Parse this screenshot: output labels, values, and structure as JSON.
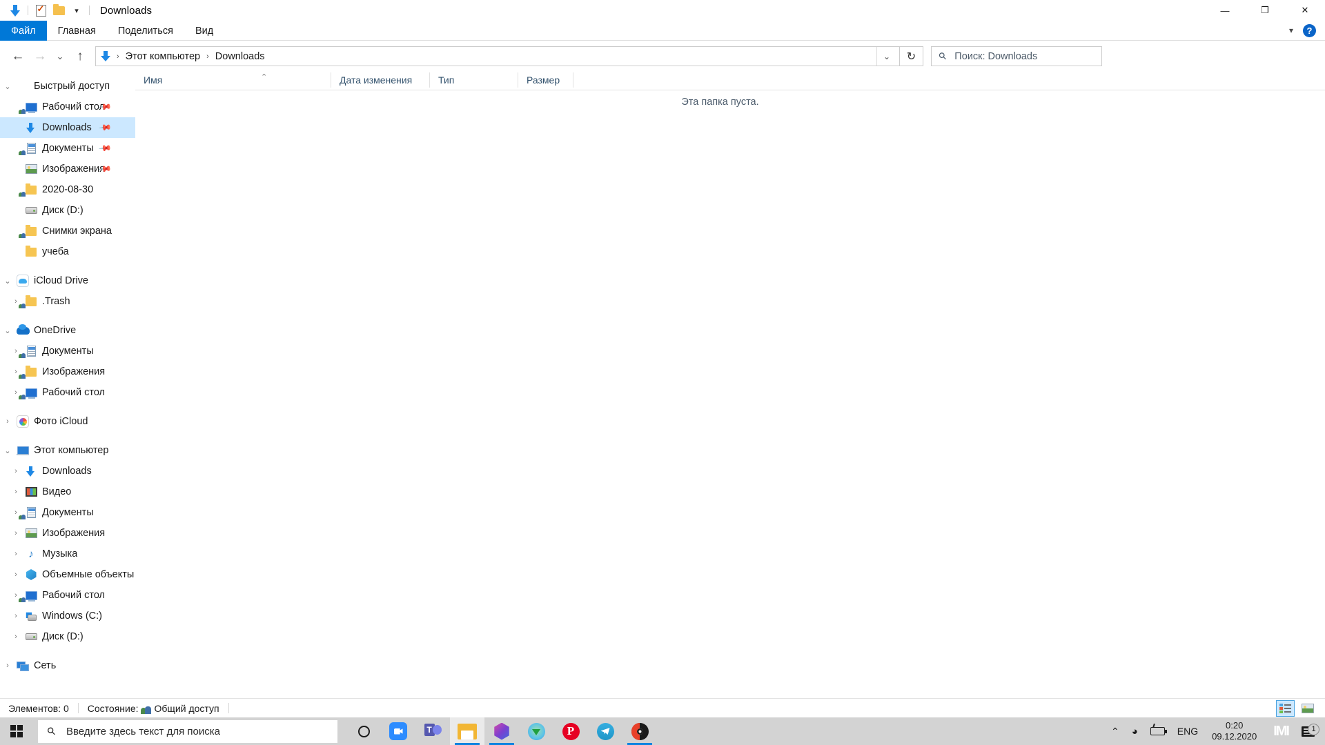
{
  "window": {
    "title": "Downloads",
    "quick_access_toolbar": [
      {
        "name": "downloads-icon",
        "glyph": "download-arrow"
      },
      {
        "name": "properties-icon",
        "glyph": "checked-document"
      },
      {
        "name": "new-folder-icon",
        "glyph": "folder"
      },
      {
        "name": "customize-qat-icon",
        "glyph": "chevron-down"
      }
    ],
    "controls": {
      "minimize": "—",
      "maximize": "❐",
      "close": "✕"
    }
  },
  "ribbon": {
    "tabs": [
      {
        "label": "Файл",
        "active": true
      },
      {
        "label": "Главная",
        "active": false
      },
      {
        "label": "Поделиться",
        "active": false
      },
      {
        "label": "Вид",
        "active": false
      }
    ],
    "collapse_icon": "chevron-down-icon",
    "help_label": "?"
  },
  "navigation": {
    "back": "←",
    "forward": "→",
    "recent": "⌄",
    "up": "↑",
    "breadcrumbs": [
      "Этот компьютер",
      "Downloads"
    ],
    "breadcrumb_separator": "›",
    "history_chevron": "⌄",
    "refresh_icon": "↻",
    "search_placeholder": "Поиск: Downloads"
  },
  "sidebar": {
    "items": [
      {
        "label": "Быстрый доступ",
        "icon": "star-icon",
        "depth": 0,
        "expander": "⌄",
        "pinned": false,
        "selected": false
      },
      {
        "label": "Рабочий стол",
        "icon": "desktop-icon",
        "depth": 1,
        "expander": "",
        "pinned": true,
        "selected": false
      },
      {
        "label": "Downloads",
        "icon": "download-icon",
        "depth": 1,
        "expander": "",
        "pinned": true,
        "selected": true
      },
      {
        "label": "Документы",
        "icon": "documents-icon",
        "depth": 1,
        "expander": "",
        "pinned": true,
        "selected": false
      },
      {
        "label": "Изображения",
        "icon": "pictures-icon",
        "depth": 1,
        "expander": "",
        "pinned": true,
        "selected": false
      },
      {
        "label": "2020-08-30",
        "icon": "folder-shared-icon",
        "depth": 1,
        "expander": "",
        "pinned": false,
        "selected": false
      },
      {
        "label": "Диск  (D:)",
        "icon": "disk-icon",
        "depth": 1,
        "expander": "",
        "pinned": false,
        "selected": false
      },
      {
        "label": "Снимки экрана",
        "icon": "folder-shared-icon",
        "depth": 1,
        "expander": "",
        "pinned": false,
        "selected": false
      },
      {
        "label": "учеба",
        "icon": "folder-icon",
        "depth": 1,
        "expander": "",
        "pinned": false,
        "selected": false
      },
      {
        "label": "iCloud Drive",
        "icon": "icloud-icon",
        "depth": 0,
        "expander": "⌄",
        "pinned": false,
        "selected": false
      },
      {
        "label": ".Trash",
        "icon": "folder-shared-icon",
        "depth": 1,
        "expander": "›",
        "pinned": false,
        "selected": false
      },
      {
        "label": "OneDrive",
        "icon": "onedrive-icon",
        "depth": 0,
        "expander": "⌄",
        "pinned": false,
        "selected": false
      },
      {
        "label": "Документы",
        "icon": "documents-icon",
        "depth": 1,
        "expander": "›",
        "pinned": false,
        "selected": false
      },
      {
        "label": "Изображения",
        "icon": "folder-shared-icon",
        "depth": 1,
        "expander": "›",
        "pinned": false,
        "selected": false
      },
      {
        "label": "Рабочий стол",
        "icon": "desktop-icon",
        "depth": 1,
        "expander": "›",
        "pinned": false,
        "selected": false
      },
      {
        "label": "Фото iCloud",
        "icon": "photos-icon",
        "depth": 0,
        "expander": "›",
        "pinned": false,
        "selected": false
      },
      {
        "label": "Этот компьютер",
        "icon": "this-pc-icon",
        "depth": 0,
        "expander": "⌄",
        "pinned": false,
        "selected": false
      },
      {
        "label": "Downloads",
        "icon": "download-icon",
        "depth": 1,
        "expander": "›",
        "pinned": false,
        "selected": false
      },
      {
        "label": "Видео",
        "icon": "videos-icon",
        "depth": 1,
        "expander": "›",
        "pinned": false,
        "selected": false
      },
      {
        "label": "Документы",
        "icon": "documents-icon",
        "depth": 1,
        "expander": "›",
        "pinned": false,
        "selected": false
      },
      {
        "label": "Изображения",
        "icon": "pictures-icon",
        "depth": 1,
        "expander": "›",
        "pinned": false,
        "selected": false
      },
      {
        "label": "Музыка",
        "icon": "music-icon",
        "depth": 1,
        "expander": "›",
        "pinned": false,
        "selected": false
      },
      {
        "label": "Объемные объекты",
        "icon": "3d-objects-icon",
        "depth": 1,
        "expander": "›",
        "pinned": false,
        "selected": false
      },
      {
        "label": "Рабочий стол",
        "icon": "desktop-icon",
        "depth": 1,
        "expander": "›",
        "pinned": false,
        "selected": false
      },
      {
        "label": "Windows (C:)",
        "icon": "windows-drive-icon",
        "depth": 1,
        "expander": "›",
        "pinned": false,
        "selected": false
      },
      {
        "label": "Диск  (D:)",
        "icon": "disk-icon",
        "depth": 1,
        "expander": "›",
        "pinned": false,
        "selected": false
      },
      {
        "label": "Сеть",
        "icon": "network-icon",
        "depth": 0,
        "expander": "›",
        "pinned": false,
        "selected": false
      }
    ]
  },
  "filelist": {
    "columns": [
      "Имя",
      "Дата изменения",
      "Тип",
      "Размер"
    ],
    "sort_indicator": "⌃",
    "rows": [],
    "empty_message": "Эта папка пуста."
  },
  "statusbar": {
    "items_label": "Элементов: 0",
    "state_label": "Состояние:",
    "share_label": "Общий доступ",
    "view_buttons": [
      {
        "name": "details-view-button",
        "active": true
      },
      {
        "name": "large-icons-view-button",
        "active": false
      }
    ]
  },
  "taskbar": {
    "start_label": "start-button",
    "search_placeholder": "Введите здесь текст для поиска",
    "apps": [
      {
        "name": "cortana-button",
        "icon": "cortana-icon",
        "running": false,
        "active": false
      },
      {
        "name": "zoom-app",
        "icon": "zoom-icon",
        "running": false,
        "active": false
      },
      {
        "name": "teams-app",
        "icon": "teams-icon",
        "running": false,
        "active": false
      },
      {
        "name": "file-explorer-app",
        "icon": "file-explorer-icon",
        "running": true,
        "active": true
      },
      {
        "name": "gem-app",
        "icon": "gem-icon",
        "running": true,
        "active": false
      },
      {
        "name": "download-manager-app",
        "icon": "download-manager-icon",
        "running": false,
        "active": false
      },
      {
        "name": "pinterest-app",
        "icon": "pinterest-icon",
        "running": false,
        "active": false
      },
      {
        "name": "telegram-app",
        "icon": "telegram-icon",
        "running": false,
        "active": false
      },
      {
        "name": "media-player-app",
        "icon": "media-player-icon",
        "running": true,
        "active": false
      }
    ],
    "tray": {
      "show_hidden": "⌃",
      "language": "ENG",
      "time": "0:20",
      "date": "09.12.2020",
      "brand_mark": "IMI",
      "notification_count": "1"
    }
  }
}
